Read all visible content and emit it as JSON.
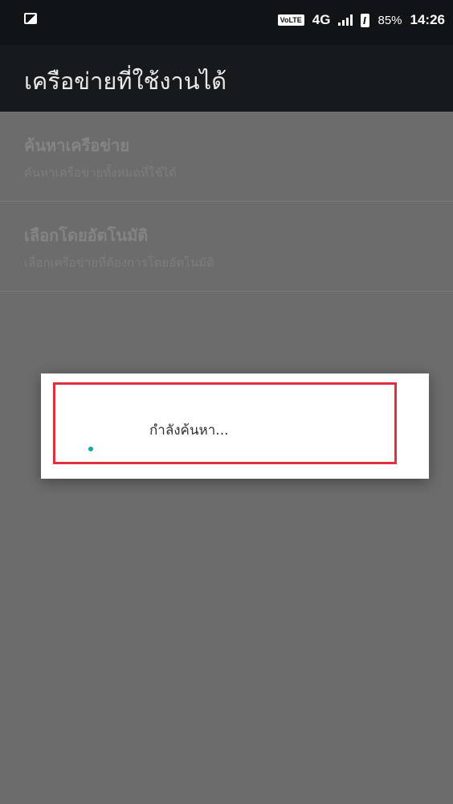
{
  "status_bar": {
    "network_badge": "VoLTE",
    "network_type": "4G",
    "battery_percent": "85%",
    "time": "14:26"
  },
  "toolbar": {
    "title": "เครือข่ายที่ใช้งานได้"
  },
  "list": {
    "items": [
      {
        "title": "ค้นหาเครือข่าย",
        "subtitle": "ค้นหาเครือข่ายทั้งหมดที่ใช้ได้"
      },
      {
        "title": "เลือกโดยอัตโนมัติ",
        "subtitle": "เลือกเครือข่ายที่ต้องการโดยอัตโนมัติ"
      }
    ]
  },
  "dialog": {
    "message": "กำลังค้นหา..."
  },
  "colors": {
    "highlight": "#e0303e",
    "spinner": "#13a7a7"
  }
}
